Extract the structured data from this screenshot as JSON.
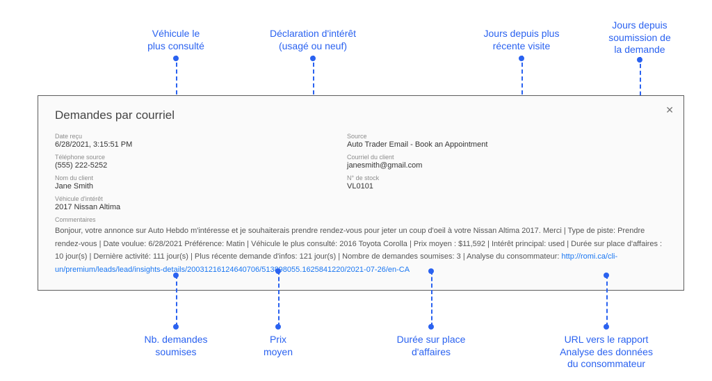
{
  "annotations": {
    "top": {
      "vehicle": "Véhicule le\nplus consulté",
      "interest": "Déclaration d'intérêt\n(usagé ou neuf)",
      "daysVisit": "Jours depuis  plus\nrécente visite",
      "daysSubmit": "Jours depuis\nsoumission de\nla demande"
    },
    "bottom": {
      "submitted": "Nb. demandes\nsoumises",
      "avgPrice": "Prix\nmoyen",
      "timeOnSite": "Durée sur  place\nd'affaires",
      "url": "URL vers le rapport\nAnalyse des données\ndu consommateur"
    }
  },
  "card": {
    "title": "Demandes par courriel",
    "fields": {
      "dateReceivedLabel": "Date reçu",
      "dateReceived": "6/28/2021, 3:15:51 PM",
      "phoneLabel": "Téléphone source",
      "phone": "(555) 222-5252",
      "nameLabel": "Nom du client",
      "name": "Jane Smith",
      "vehicleLabel": "Véhicule d'intérêt",
      "vehicle": "2017 Nissan Altima",
      "sourceLabel": "Source",
      "source": "Auto Trader Email - Book an Appointment",
      "emailLabel": "Courriel du client",
      "email": "janesmith@gmail.com",
      "stockLabel": "N° de stock",
      "stock": "VL0101"
    },
    "commentsLabel": "Commentaires",
    "commentsText1": "Bonjour, votre annonce sur Auto Hebdo m'intéresse et je souhaiterais prendre rendez-vous pour jeter un coup d'oeil à votre Nissan Altima 2017. Merci | Type de piste: Prendre rendez-vous | Date voulue: 6/28/2021 Préférence: Matin | Véhicule le plus consulté: 2016 Toyota Corolla | Prix moyen : $11,592 | Intérêt principal: used | Durée sur place d'affaires : 10 jour(s) | Dernière activité: 111 jour(s) | Plus récente demande d'infos: 121 jour(s) | Nombre de demandes soumises: 3 | Analyse du consommateur: ",
    "commentsLink": "http://romi.ca/cli-un/premium/leads/lead/insights-details/20031216124640706/513898055.1625841220/2021-07-26/en-CA"
  }
}
